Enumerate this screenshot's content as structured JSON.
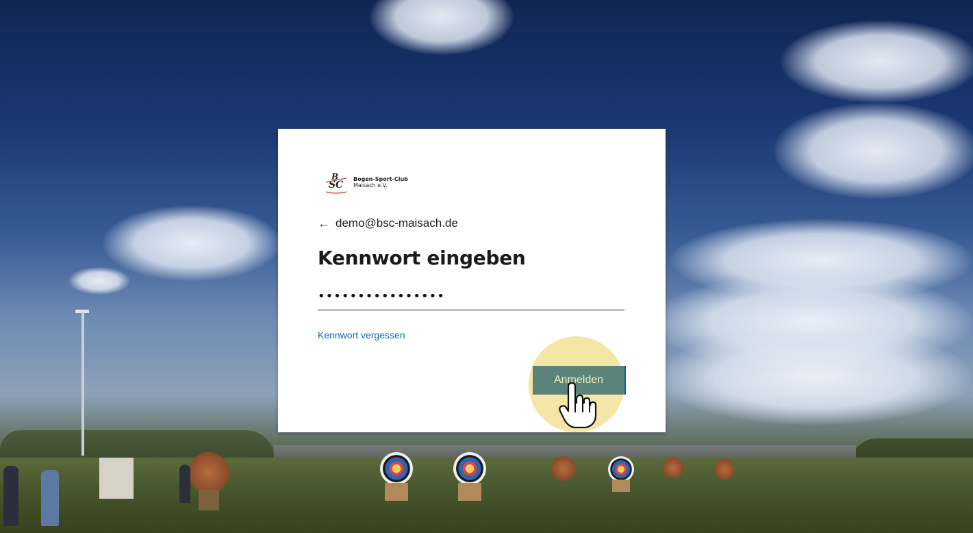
{
  "brand": {
    "logo_icon": "bsc-maisach-logo-icon",
    "name_line1": "Bogen-Sport-Club",
    "name_line2": "Maisach e.V."
  },
  "identity": {
    "back_icon": "arrow-left-icon",
    "email": "demo@bsc-maisach.de"
  },
  "form": {
    "title": "Kennwort eingeben",
    "password_masked": "••••••••••••••••",
    "forgot_link": "Kennwort vergessen",
    "submit_label": "Anmelden"
  },
  "colors": {
    "accent": "#0067b8",
    "link": "#0b67c2",
    "highlight": "#f0d76e"
  },
  "cursor": {
    "icon": "hand-pointer-icon"
  }
}
